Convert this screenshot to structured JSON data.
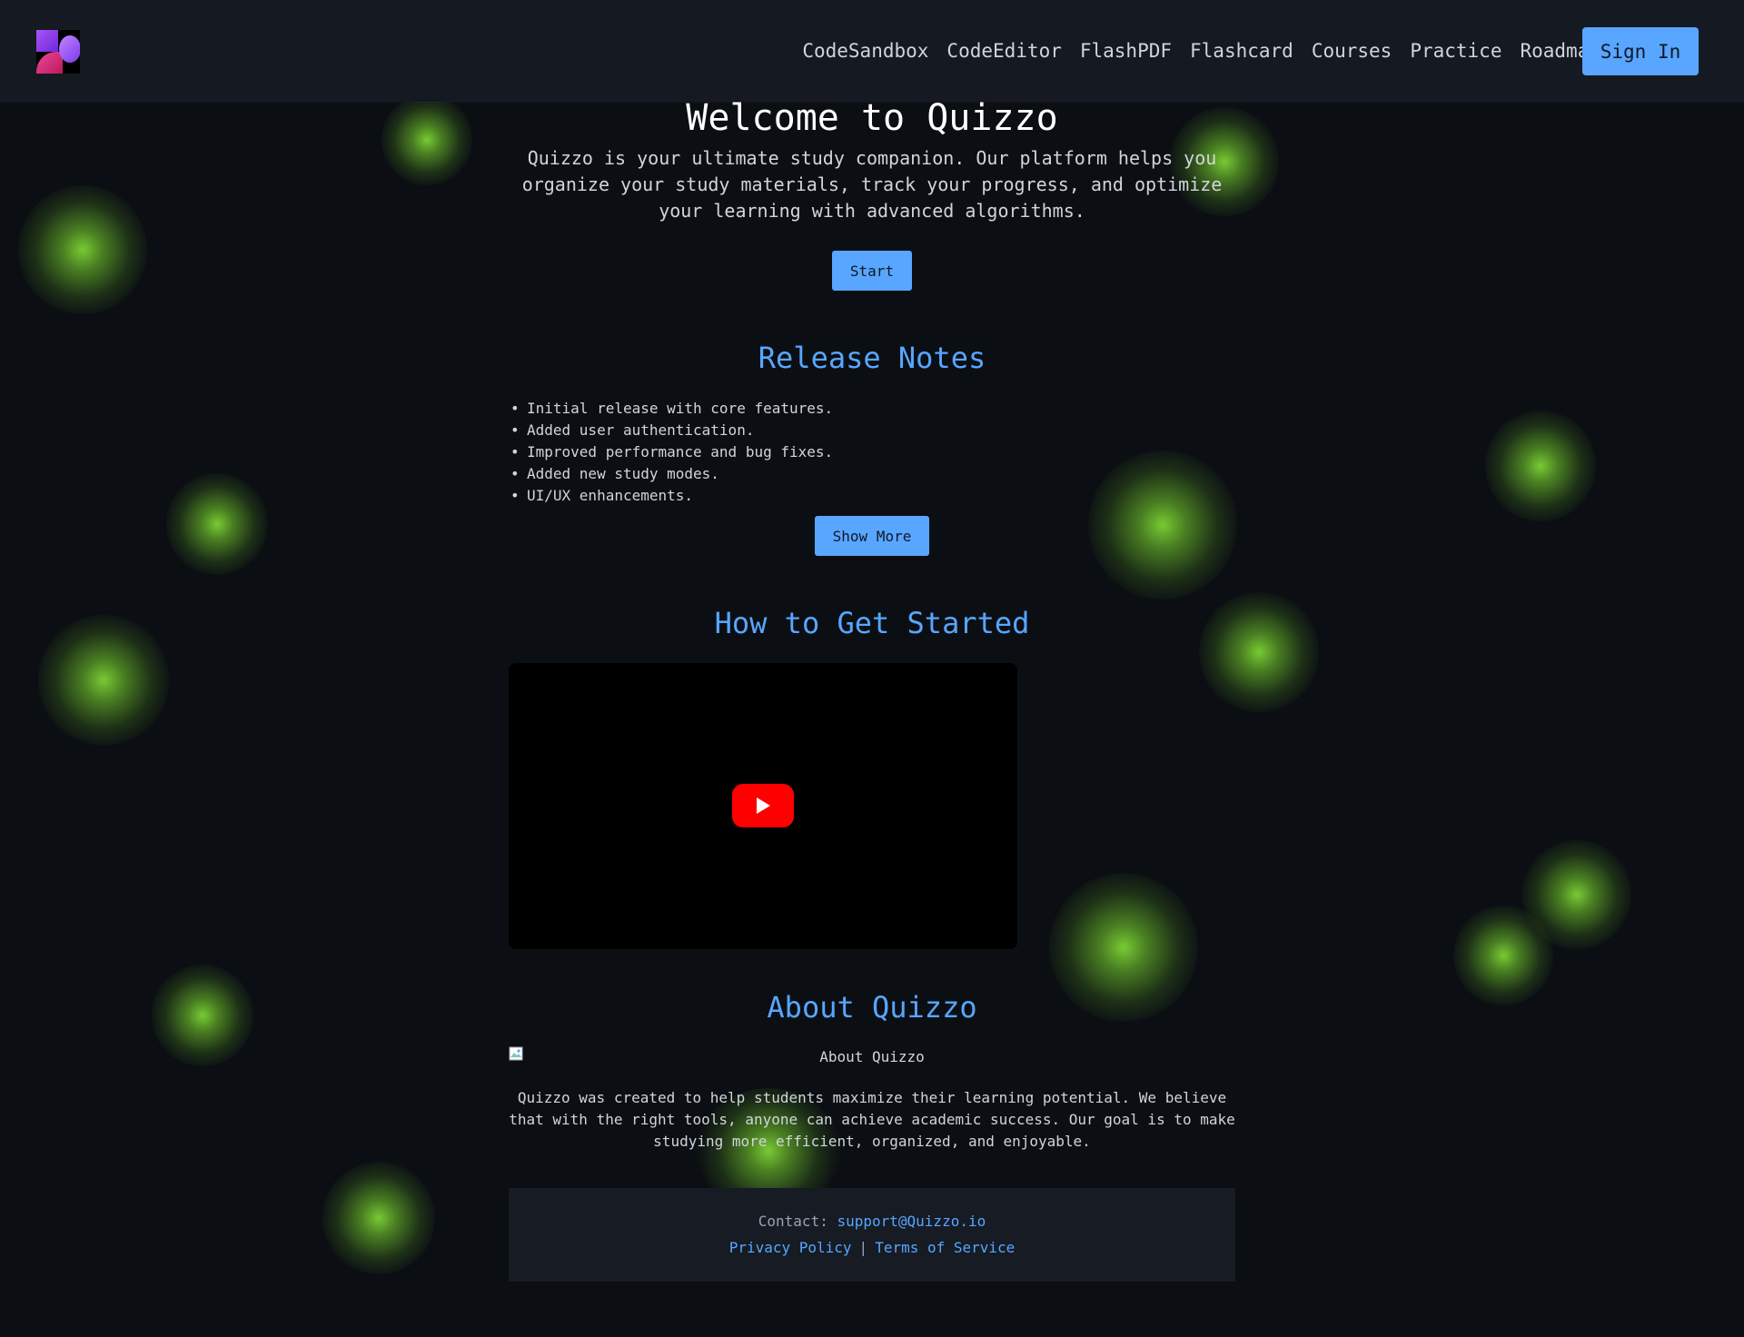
{
  "colors": {
    "background": "#0b0f14",
    "navbar": "#141922",
    "accent": "#58a6ff",
    "glow": "#7ace34",
    "text": "#d1d5db",
    "youtube_red": "#ff0000"
  },
  "nav": {
    "logo_icon": "quizzo-logo-icon",
    "links": [
      "CodeSandbox",
      "CodeEditor",
      "FlashPDF",
      "Flashcard",
      "Courses",
      "Practice",
      "Roadmap"
    ],
    "signin_label": "Sign In"
  },
  "hero": {
    "title": "Welcome to Quizzo",
    "text": "Quizzo is your ultimate study companion. Our platform helps you organize your study materials, track your progress, and optimize your learning with advanced algorithms.",
    "start_label": "Start"
  },
  "release_notes": {
    "title": "Release Notes",
    "items": [
      "Initial release with core features.",
      "Added user authentication.",
      "Improved performance and bug fixes.",
      "Added new study modes.",
      "UI/UX enhancements."
    ],
    "show_more_label": "Show More"
  },
  "get_started": {
    "title": "How to Get Started",
    "video_icon": "youtube-play-icon"
  },
  "about": {
    "title": "About Quizzo",
    "image_alt": "About Quizzo",
    "text": "Quizzo was created to help students maximize their learning potential. We believe that with the right tools, anyone can achieve academic success. Our goal is to make studying more efficient, organized, and enjoyable."
  },
  "footer": {
    "contact_label": "Contact:",
    "contact_email": "support@Quizzo.io",
    "privacy_label": "Privacy Policy",
    "separator": "|",
    "terms_label": "Terms of Service"
  }
}
